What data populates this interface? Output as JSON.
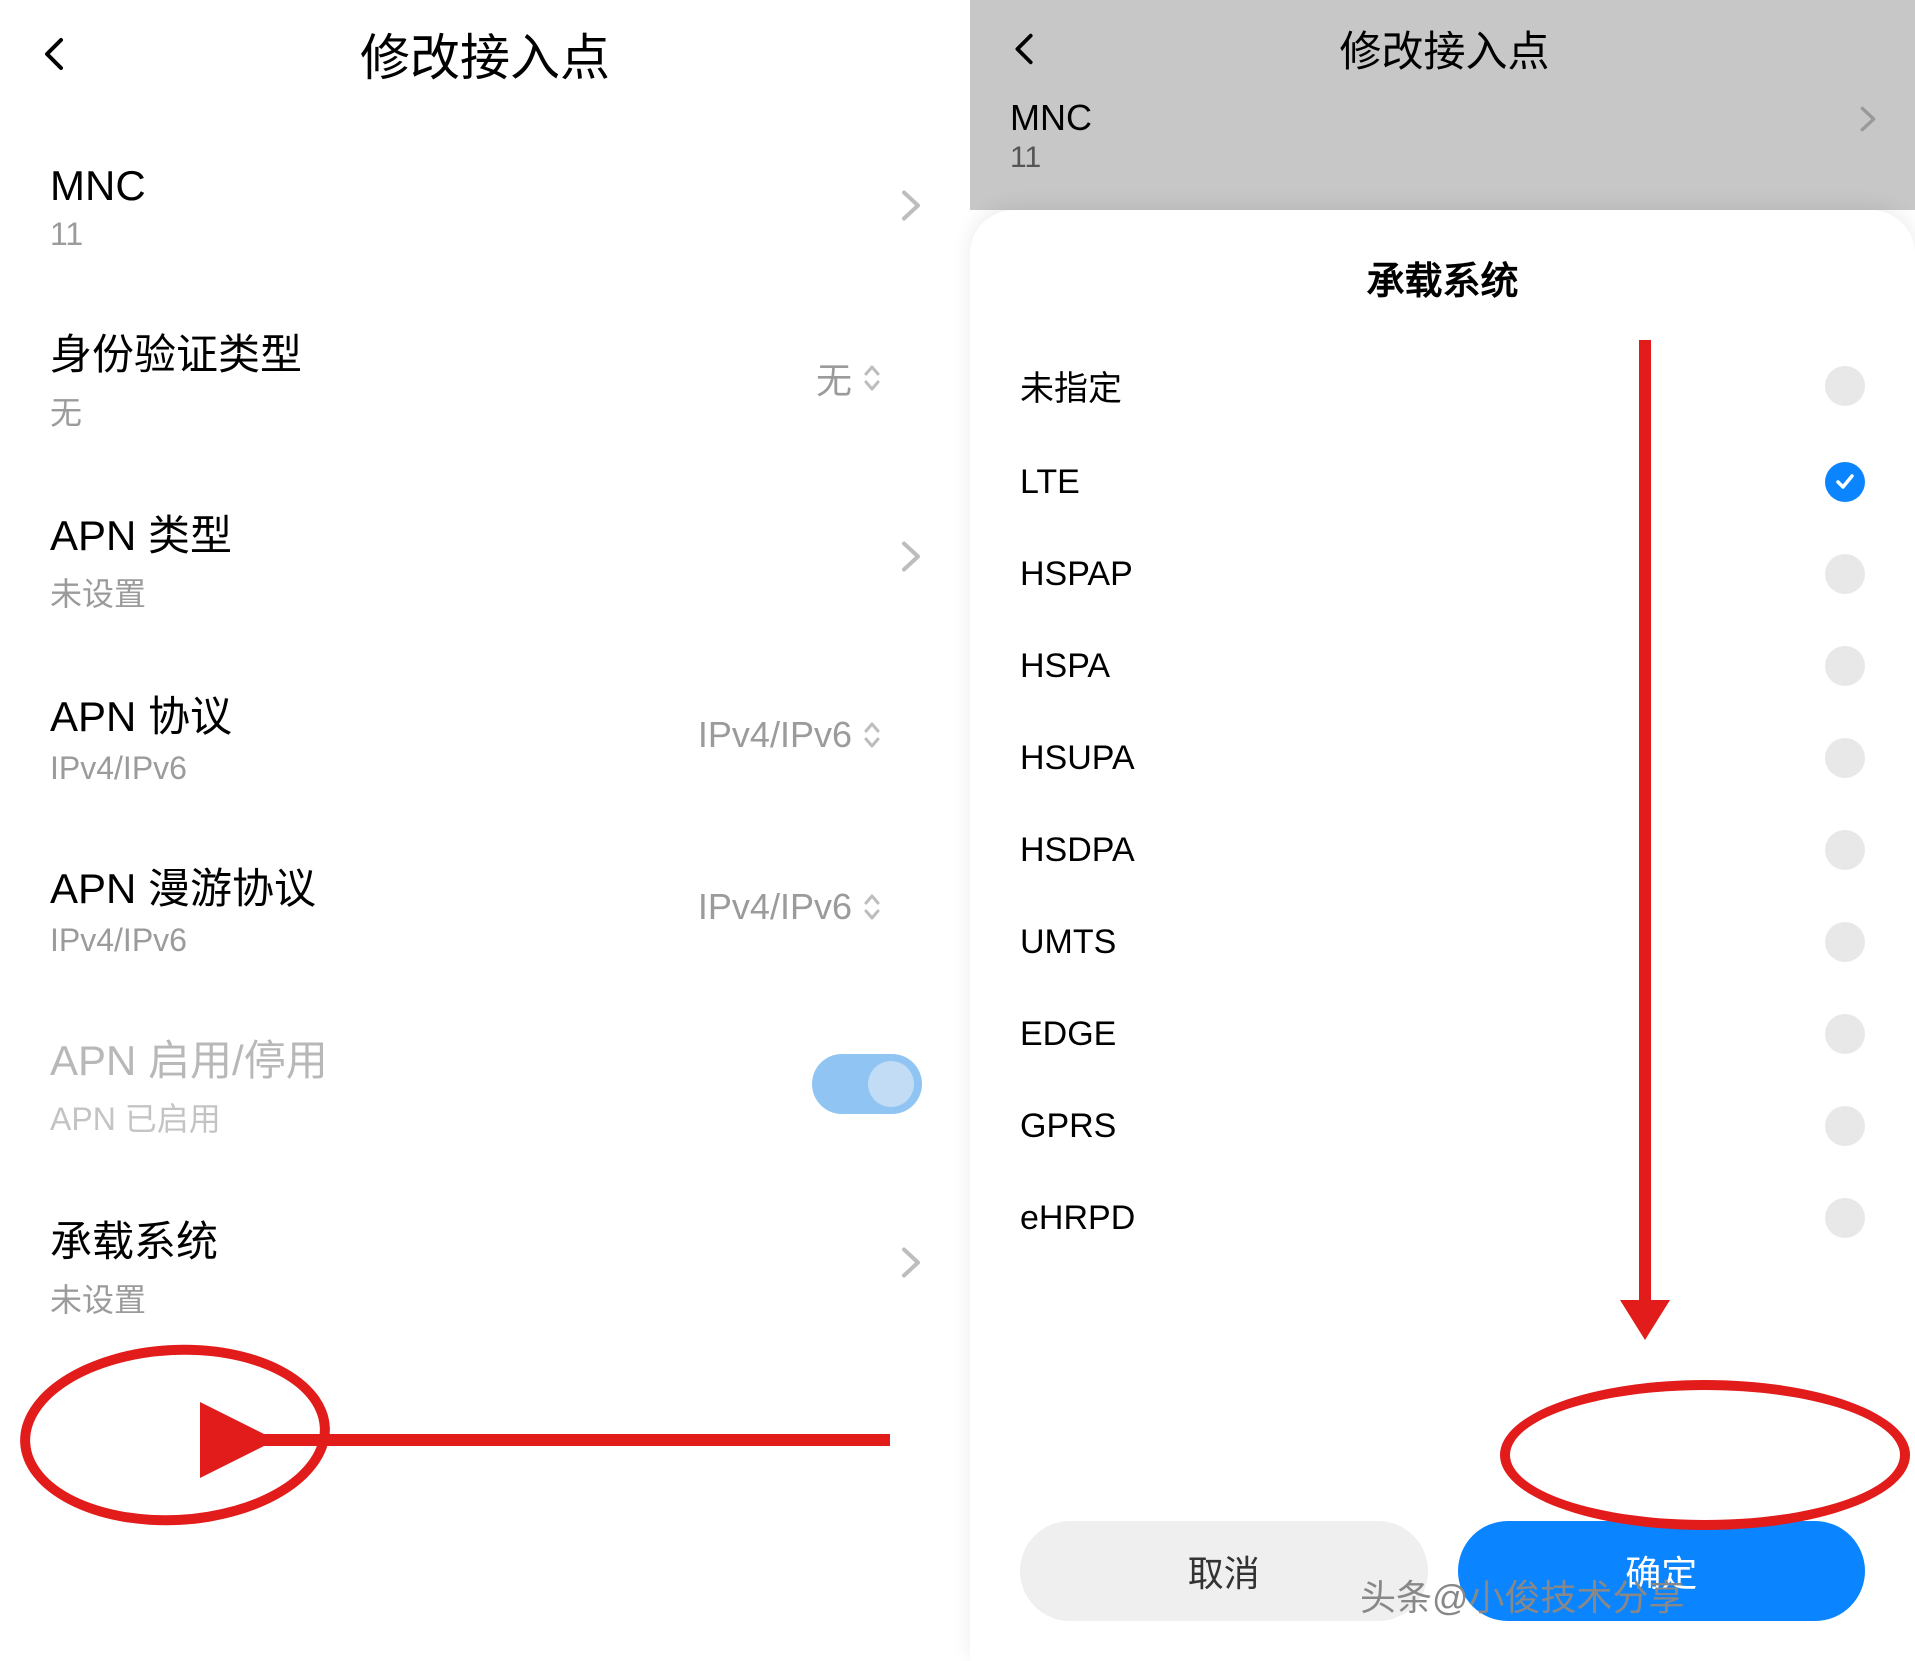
{
  "left": {
    "header": {
      "title": "修改接入点"
    },
    "rows": {
      "mnc": {
        "label": "MNC",
        "sub": "11"
      },
      "auth": {
        "label": "身份验证类型",
        "sub": "无",
        "value": "无"
      },
      "apntype": {
        "label": "APN 类型",
        "sub": "未设置"
      },
      "apnproto": {
        "label": "APN 协议",
        "sub": "IPv4/IPv6",
        "value": "IPv4/IPv6"
      },
      "apnroam": {
        "label": "APN 漫游协议",
        "sub": "IPv4/IPv6",
        "value": "IPv4/IPv6"
      },
      "apnenab": {
        "label": "APN 启用/停用",
        "sub": "APN 已启用",
        "toggle": true
      },
      "bearer": {
        "label": "承载系统",
        "sub": "未设置"
      }
    }
  },
  "right": {
    "header": {
      "title": "修改接入点"
    },
    "mnc": {
      "label": "MNC",
      "sub": "11"
    },
    "sheet": {
      "title": "承载系统",
      "options": [
        {
          "label": "未指定",
          "checked": false
        },
        {
          "label": "LTE",
          "checked": true
        },
        {
          "label": "HSPAP",
          "checked": false
        },
        {
          "label": "HSPA",
          "checked": false
        },
        {
          "label": "HSUPA",
          "checked": false
        },
        {
          "label": "HSDPA",
          "checked": false
        },
        {
          "label": "UMTS",
          "checked": false
        },
        {
          "label": "EDGE",
          "checked": false
        },
        {
          "label": "GPRS",
          "checked": false
        },
        {
          "label": "eHRPD",
          "checked": false
        }
      ],
      "cancel": "取消",
      "ok": "确定"
    }
  },
  "watermark": "头条@小俊技术分享"
}
